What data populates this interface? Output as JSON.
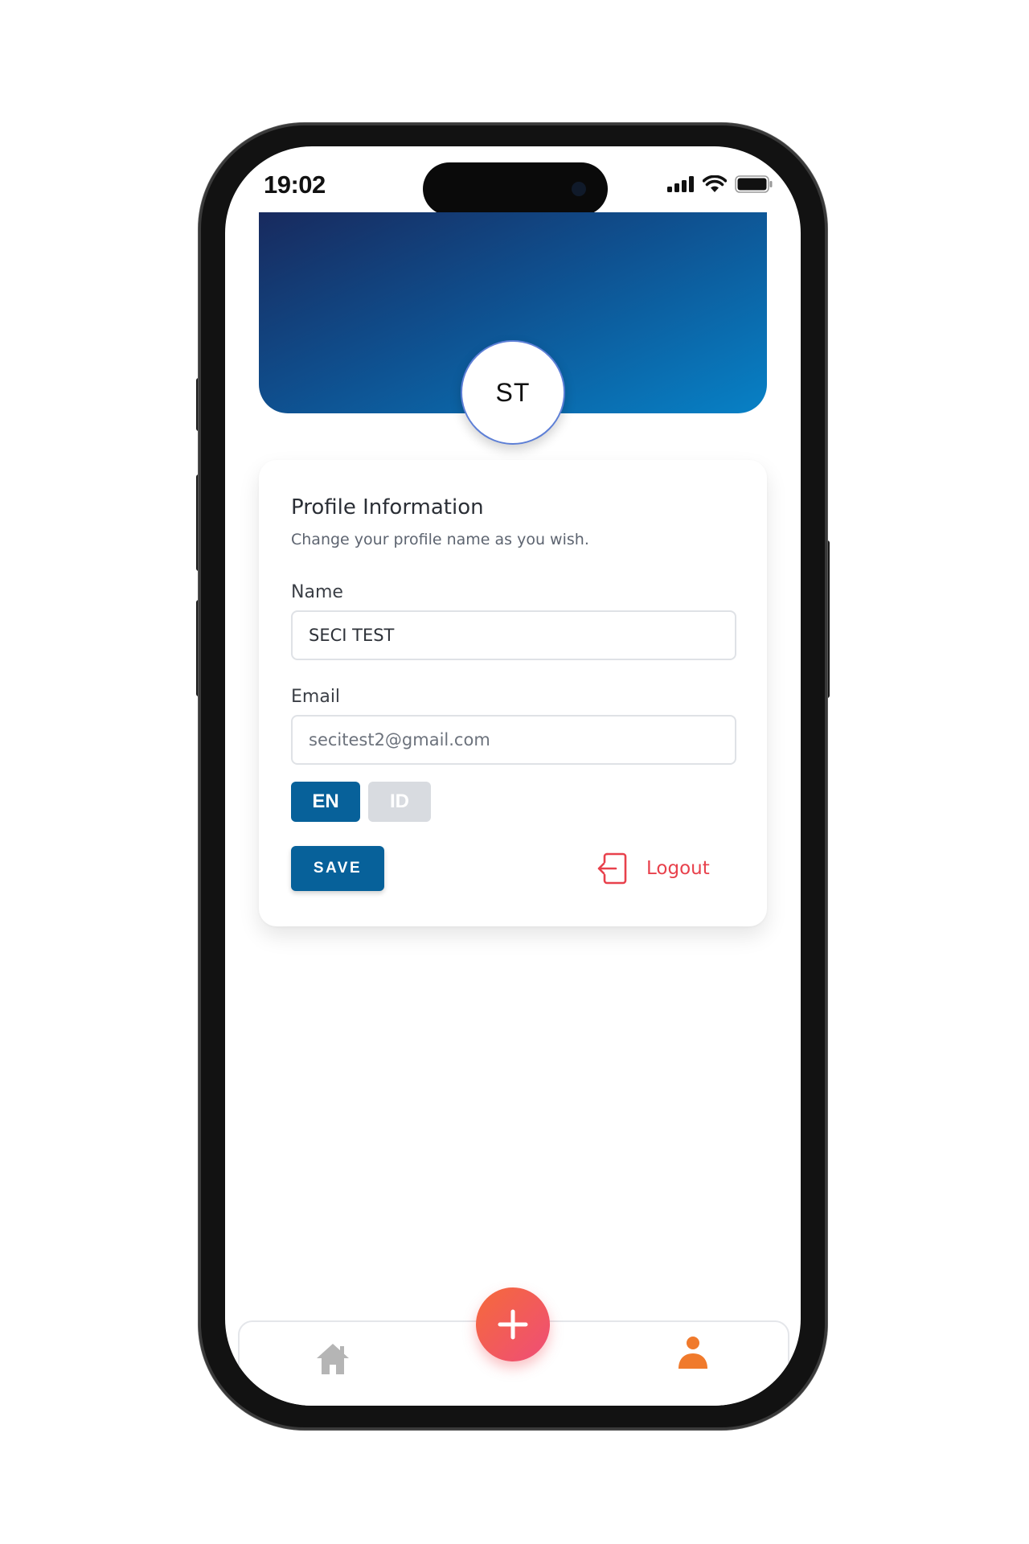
{
  "status_bar": {
    "time": "19:02",
    "icons": [
      "cellular-signal-icon",
      "wifi-icon",
      "battery-icon"
    ]
  },
  "header": {
    "avatar_initials": "ST"
  },
  "profile": {
    "title": "Profile Information",
    "subtitle": "Change your profile name as you wish.",
    "name_label": "Name",
    "name_value": "SECI TEST",
    "email_label": "Email",
    "email_value": "secitest2@gmail.com",
    "languages": [
      {
        "code": "EN",
        "selected": true
      },
      {
        "code": "ID",
        "selected": false
      }
    ],
    "save_label": "SAVE",
    "logout_label": "Logout"
  },
  "bottom_nav": {
    "items": [
      {
        "icon": "home-icon",
        "active": false
      },
      {
        "icon": "plus-icon",
        "active": false
      },
      {
        "icon": "user-icon",
        "active": true
      }
    ]
  },
  "colors": {
    "primary": "#07619a",
    "banner_start": "#182a5e",
    "banner_end": "#0781c6",
    "danger": "#e8414c",
    "fab_start": "#f56a3a",
    "fab_end": "#ef4d78",
    "active_nav": "#f07a2c",
    "inactive_nav": "#b5b5b5"
  }
}
